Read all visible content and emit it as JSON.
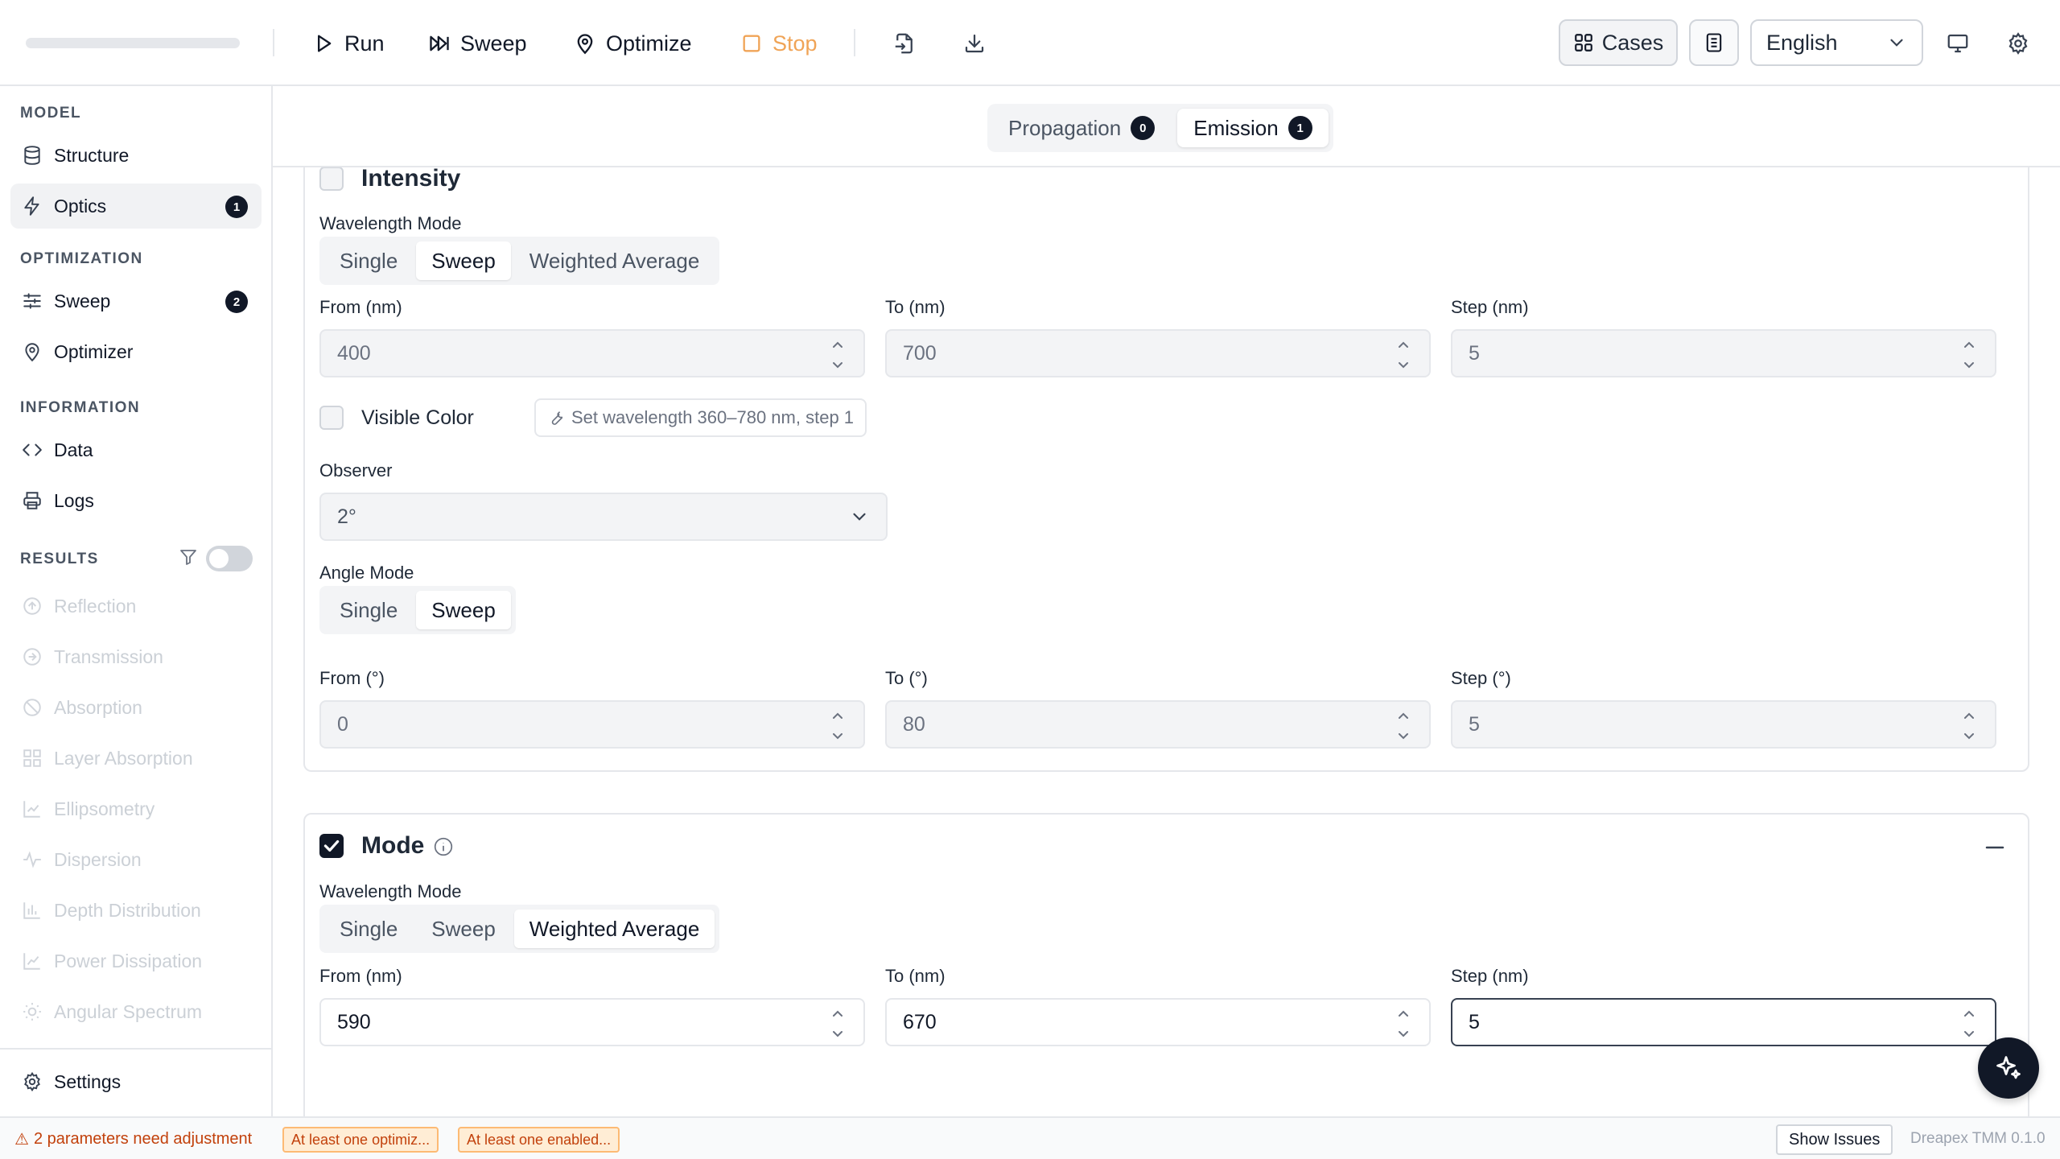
{
  "toolbar": {
    "run": "Run",
    "sweep": "Sweep",
    "optimize": "Optimize",
    "stop": "Stop",
    "cases": "Cases",
    "language": "English"
  },
  "sidebar": {
    "sections": {
      "model": "MODEL",
      "optimization": "OPTIMIZATION",
      "information": "INFORMATION",
      "results": "RESULTS"
    },
    "items": {
      "structure": "Structure",
      "optics": "Optics",
      "optics_badge": "1",
      "sweep": "Sweep",
      "sweep_badge": "2",
      "optimizer": "Optimizer",
      "data": "Data",
      "logs": "Logs",
      "settings": "Settings"
    },
    "results": [
      "Reflection",
      "Transmission",
      "Absorption",
      "Layer Absorption",
      "Ellipsometry",
      "Dispersion",
      "Depth Distribution",
      "Power Dissipation",
      "Angular Spectrum"
    ]
  },
  "tabs": {
    "propagation": "Propagation",
    "propagation_badge": "0",
    "emission": "Emission",
    "emission_badge": "1"
  },
  "intensity": {
    "title": "Intensity",
    "wavelength_mode_label": "Wavelength Mode",
    "wavelength_modes": [
      "Single",
      "Sweep",
      "Weighted Average"
    ],
    "wavelength_mode_selected": "Sweep",
    "from_label": "From (nm)",
    "to_label": "To (nm)",
    "step_label": "Step (nm)",
    "from": "400",
    "to": "700",
    "step": "5",
    "visible_color_label": "Visible Color",
    "visible_color_checked": false,
    "set_wavelength_hint": "Set wavelength 360–780 nm, step 1",
    "observer_label": "Observer",
    "observer": "2°",
    "angle_mode_label": "Angle Mode",
    "angle_modes": [
      "Single",
      "Sweep"
    ],
    "angle_mode_selected": "Sweep",
    "angle_from_label": "From (°)",
    "angle_to_label": "To (°)",
    "angle_step_label": "Step (°)",
    "angle_from": "0",
    "angle_to": "80",
    "angle_step": "5"
  },
  "mode": {
    "title": "Mode",
    "checked": true,
    "wavelength_mode_label": "Wavelength Mode",
    "wavelength_modes": [
      "Single",
      "Sweep",
      "Weighted Average"
    ],
    "wavelength_mode_selected": "Weighted Average",
    "from_label": "From (nm)",
    "to_label": "To (nm)",
    "step_label": "Step (nm)",
    "from": "590",
    "to": "670",
    "step": "5"
  },
  "status": {
    "warning": "2 parameters need adjustment",
    "chips": [
      "At least one optimiz...",
      "At least one enabled..."
    ],
    "show_issues": "Show Issues",
    "version": "Dreapex TMM 0.1.0"
  },
  "colors": {
    "accent": "#111827",
    "stop": "#f0a457",
    "warning": "#c2410c"
  }
}
